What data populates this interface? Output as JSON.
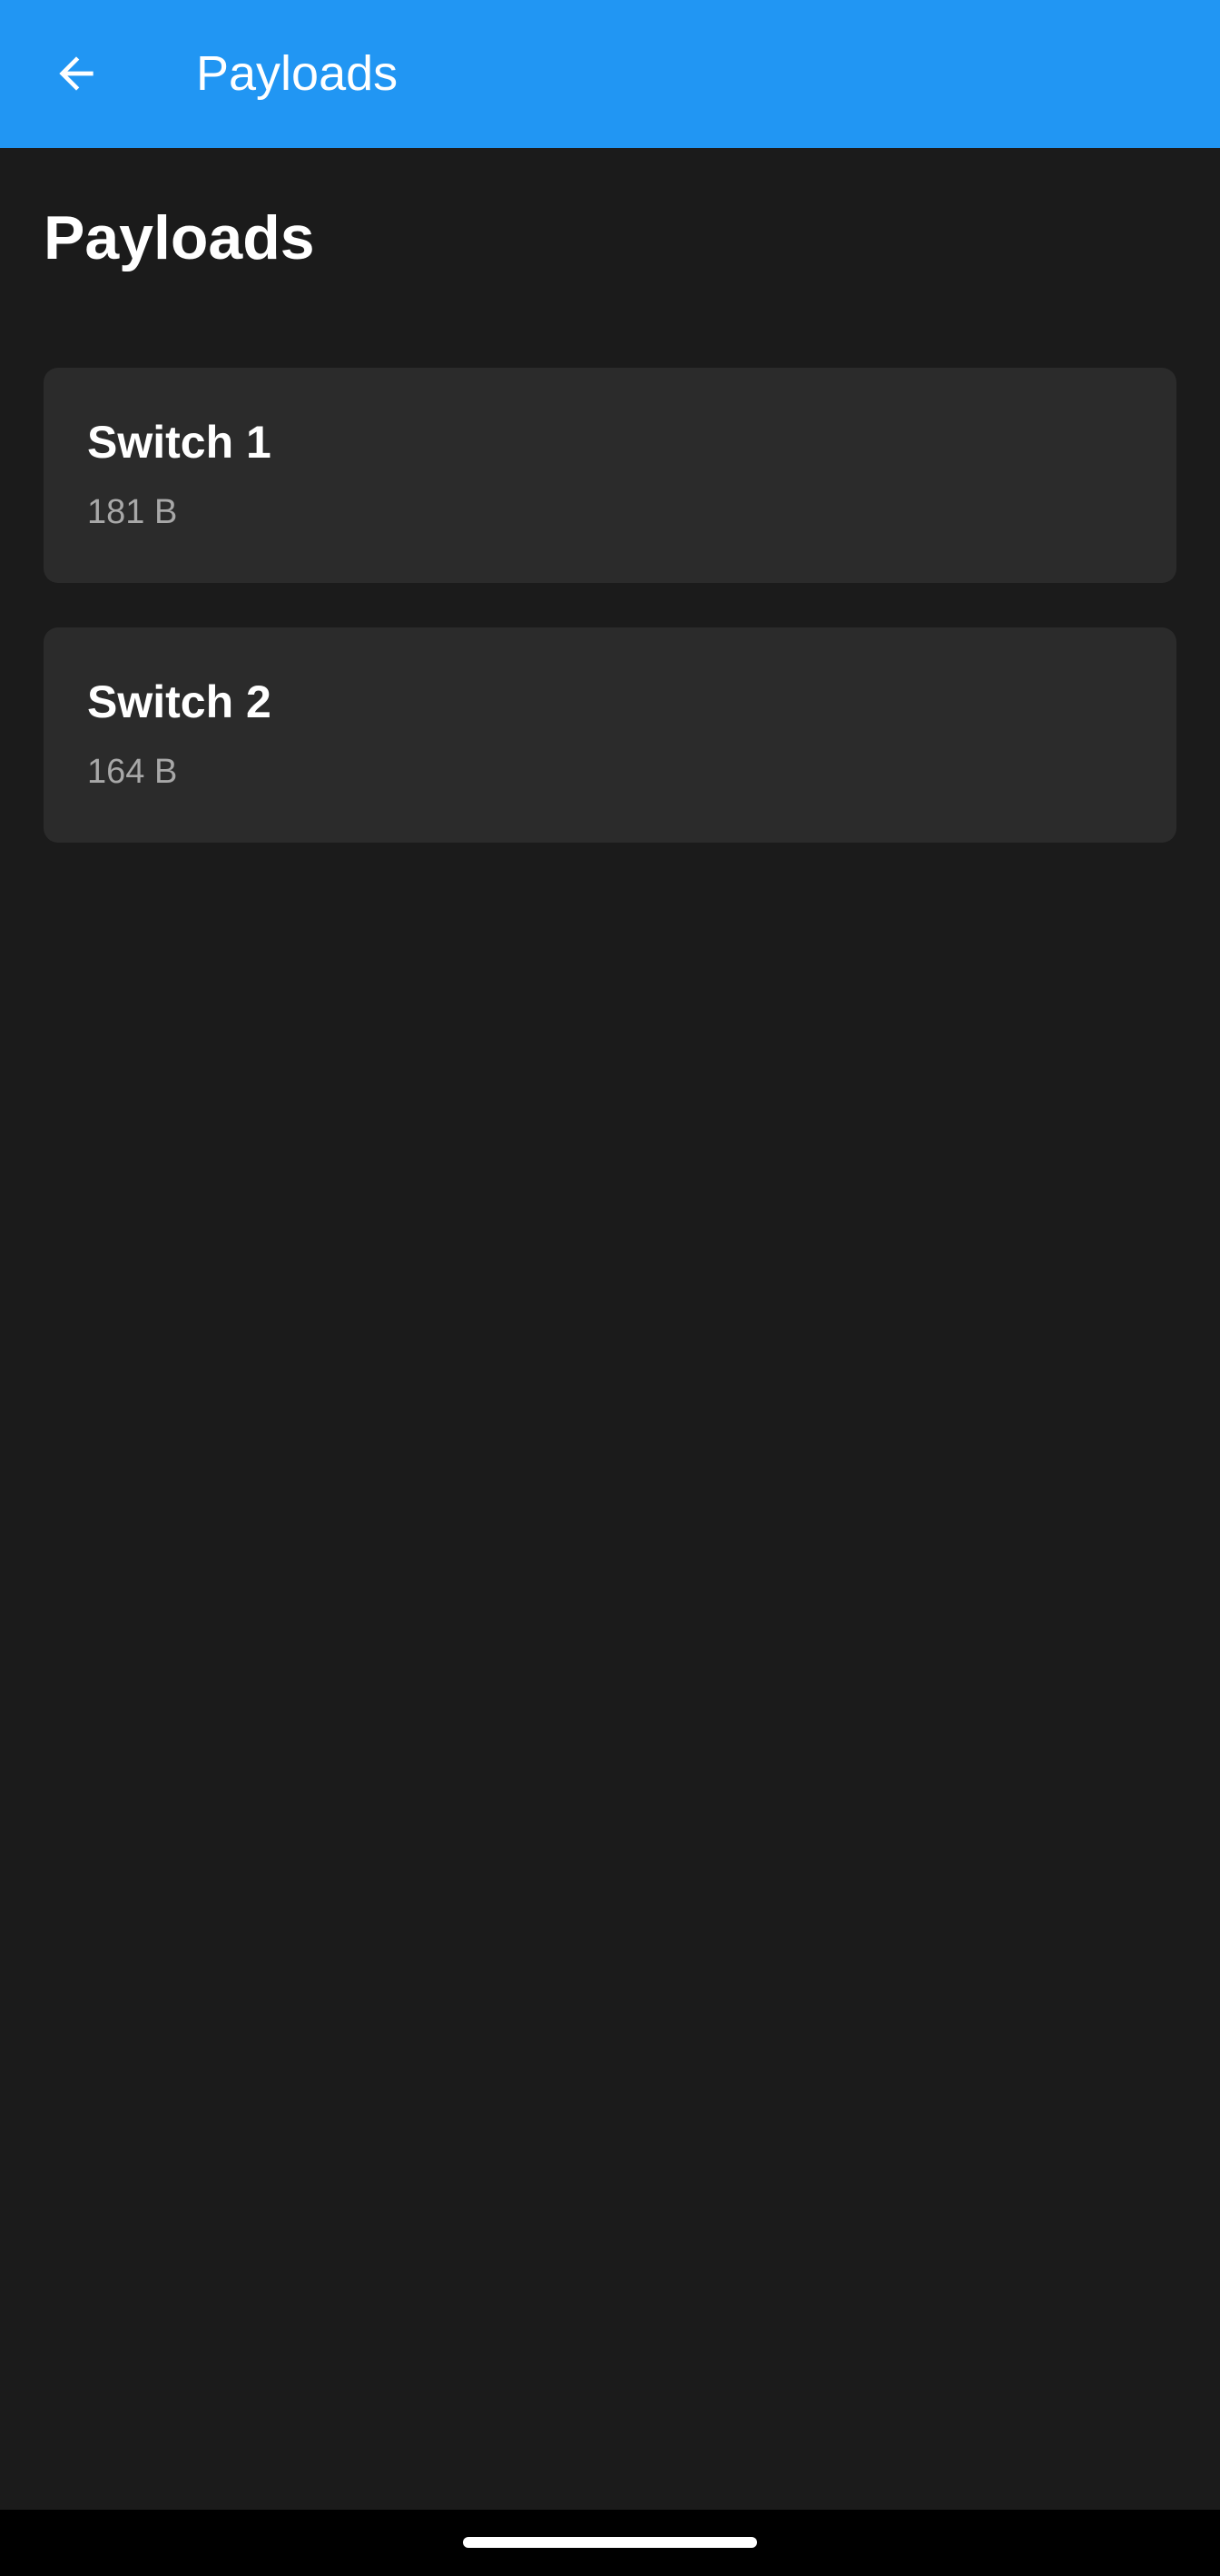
{
  "app_bar": {
    "title": "Payloads",
    "back_icon": "arrow-left-icon",
    "color": "#2196f3"
  },
  "page": {
    "title": "Payloads",
    "background": "#1b1b1b"
  },
  "payloads": [
    {
      "name": "Switch 1",
      "size": "181 B"
    },
    {
      "name": "Switch 2",
      "size": "164 B"
    }
  ]
}
